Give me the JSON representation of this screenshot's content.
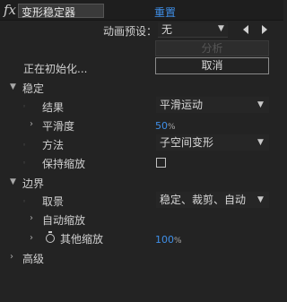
{
  "header": {
    "fx_label": "fx",
    "effect_title": "变形稳定器",
    "reset_label": "重置"
  },
  "preset": {
    "label": "动画预设：",
    "value": "无"
  },
  "analyze": {
    "button_label": "分析"
  },
  "status": {
    "init_label": "正在初始化...",
    "cancel_label": "取消"
  },
  "stabilize": {
    "title": "稳定",
    "result_label": "结果",
    "result_value": "平滑运动",
    "smoothness_label": "平滑度",
    "smoothness_value": "50",
    "smoothness_unit": "%",
    "method_label": "方法",
    "method_value": "子空间变形",
    "preserve_scale_label": "保持缩放",
    "preserve_scale_checked": false
  },
  "borders": {
    "title": "边界",
    "framing_label": "取景",
    "framing_value": "稳定、裁剪、自动",
    "auto_scale_label": "自动缩放",
    "additional_scale_label": "其他缩放",
    "additional_scale_value": "100",
    "additional_scale_unit": "%"
  },
  "advanced": {
    "title": "高级"
  }
}
